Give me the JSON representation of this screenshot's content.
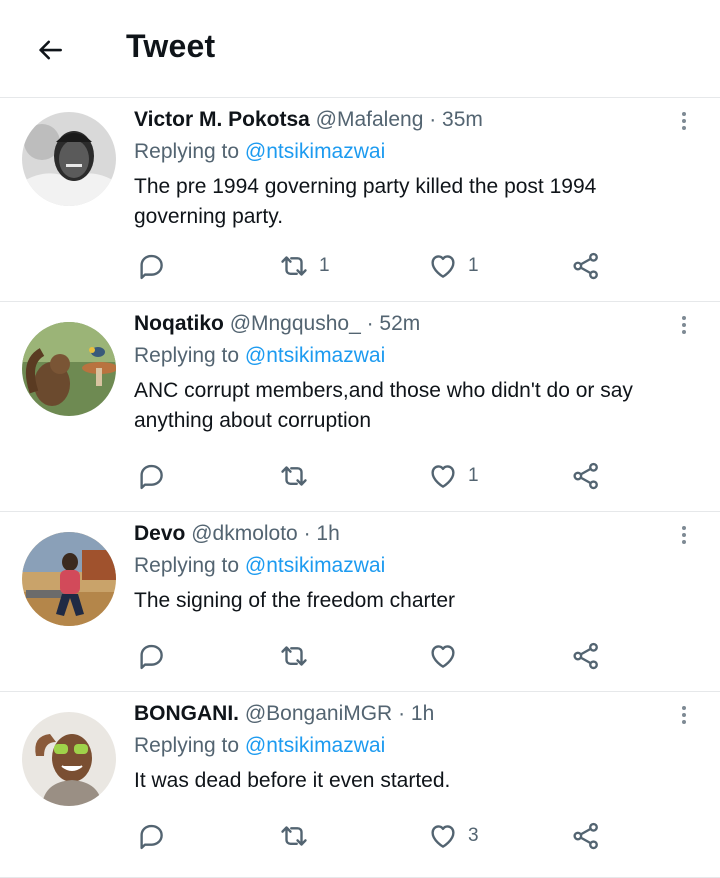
{
  "header": {
    "title": "Tweet"
  },
  "tweets": [
    {
      "name": "Victor M. Pokotsa",
      "handle": "@Mafaleng",
      "time": "· 35m",
      "replying_prefix": "Replying to",
      "replying_handle": "@ntsikimazwai",
      "text": "The pre 1994 governing party killed the post 1994 governing party.",
      "retweets": "1",
      "likes": "1"
    },
    {
      "name": "Noqatiko",
      "handle": "@Mngqusho_",
      "time": "· 52m",
      "replying_prefix": "Replying to",
      "replying_handle": "@ntsikimazwai",
      "text": "ANC corrupt members,and those who didn't do or say anything about corruption",
      "retweets": "",
      "likes": "1"
    },
    {
      "name": "Devo",
      "handle": "@dkmoloto",
      "time": "· 1h",
      "replying_prefix": "Replying to",
      "replying_handle": "@ntsikimazwai",
      "text": "The signing of the freedom charter",
      "retweets": "",
      "likes": ""
    },
    {
      "name": "BONGANI.",
      "handle": "@BonganiMGR",
      "time": "· 1h",
      "replying_prefix": "Replying to",
      "replying_handle": "@ntsikimazwai",
      "text": "It was dead before it even started.",
      "retweets": "",
      "likes": "3"
    }
  ],
  "icons": {
    "back": "arrow-left-icon",
    "more": "more-vertical-icon",
    "reply": "reply-bubble-icon",
    "retweet": "retweet-icon",
    "like": "heart-icon",
    "share": "share-icon"
  },
  "colors": {
    "accent": "#1d9bf0",
    "secondary_text": "#536471",
    "divider": "#e6e8ea"
  }
}
